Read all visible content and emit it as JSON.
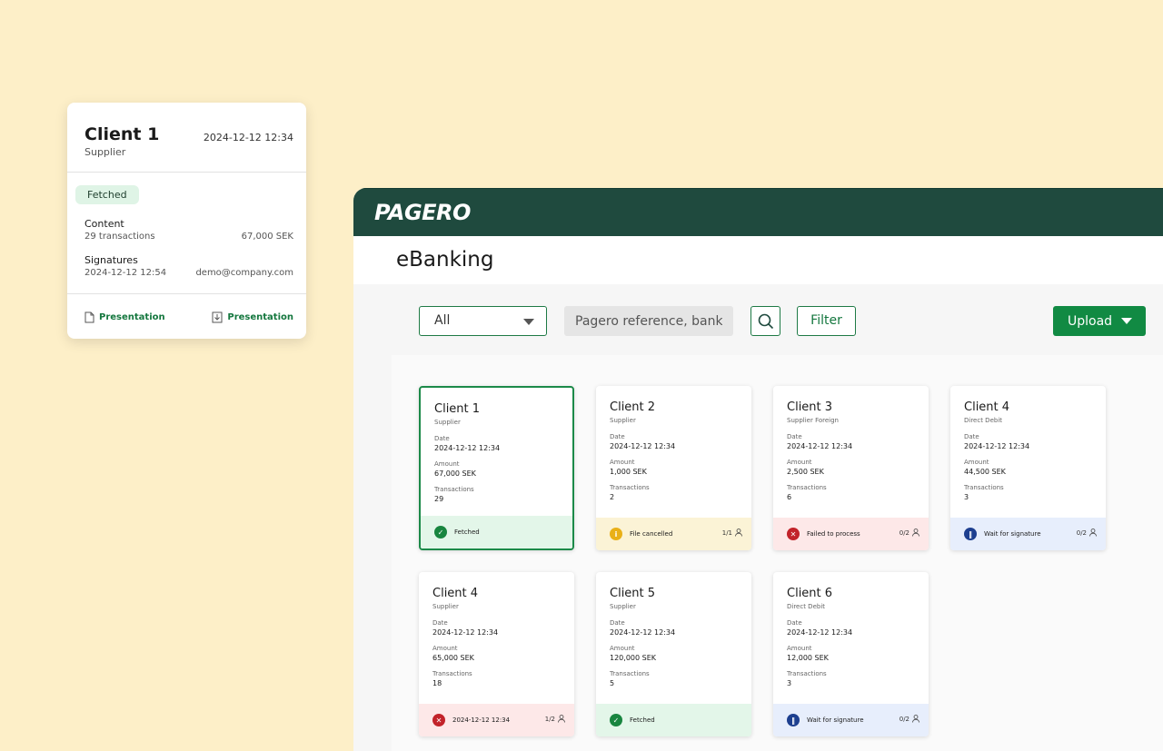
{
  "detail_card": {
    "title": "Client 1",
    "subtitle": "Supplier",
    "datetime": "2024-12-12  12:34",
    "status": "Fetched",
    "content_label": "Content",
    "content_transactions": "29 transactions",
    "content_amount": "67,000 SEK",
    "signatures_label": "Signatures",
    "signatures_datetime": "2024-12-12  12:54",
    "signatures_email": "demo@company.com",
    "link_left": "Presentation",
    "link_right": "Presentation"
  },
  "app": {
    "logo": "PAGERO",
    "page_title": "eBanking",
    "toolbar": {
      "select_value": "All",
      "search_placeholder": "Pagero reference, bank...",
      "filter_label": "Filter",
      "upload_label": "Upload"
    },
    "cards": [
      {
        "name": "Client 1",
        "type": "Supplier",
        "date_label": "Date",
        "date": "2024-12-12  12:34",
        "amount_label": "Amount",
        "amount": "67,000 SEK",
        "tx_label": "Transactions",
        "tx": "29",
        "status": "Fetched",
        "status_kind": "green",
        "count": ""
      },
      {
        "name": "Client 2",
        "type": "Supplier",
        "date_label": "Date",
        "date": "2024-12-12  12:34",
        "amount_label": "Amount",
        "amount": "1,000 SEK",
        "tx_label": "Transactions",
        "tx": "2",
        "status": "File cancelled",
        "status_kind": "yellow",
        "count": "1/1"
      },
      {
        "name": "Client 3",
        "type": "Supplier Foreign",
        "date_label": "Date",
        "date": "2024-12-12  12:34",
        "amount_label": "Amount",
        "amount": "2,500 SEK",
        "tx_label": "Transactions",
        "tx": "6",
        "status": "Failed to process",
        "status_kind": "red",
        "count": "0/2"
      },
      {
        "name": "Client 4",
        "type": "Direct Debit",
        "date_label": "Date",
        "date": "2024-12-12  12:34",
        "amount_label": "Amount",
        "amount": "44,500 SEK",
        "tx_label": "Transactions",
        "tx": "3",
        "status": "Wait for signature",
        "status_kind": "blue",
        "count": "0/2"
      },
      {
        "name": "Client 4",
        "type": "Supplier",
        "date_label": "Date",
        "date": "2024-12-12  12:34",
        "amount_label": "Amount",
        "amount": "65,000 SEK",
        "tx_label": "Transactions",
        "tx": "18",
        "status": "2024-12-12  12:34",
        "status_kind": "red",
        "count": "1/2"
      },
      {
        "name": "Client 5",
        "type": "Supplier",
        "date_label": "Date",
        "date": "2024-12-12  12:34",
        "amount_label": "Amount",
        "amount": "120,000 SEK",
        "tx_label": "Transactions",
        "tx": "5",
        "status": "Fetched",
        "status_kind": "green",
        "count": ""
      },
      {
        "name": "Client 6",
        "type": "Direct Debit",
        "date_label": "Date",
        "date": "2024-12-12  12:34",
        "amount_label": "Amount",
        "amount": "12,000 SEK",
        "tx_label": "Transactions",
        "tx": "3",
        "status": "Wait for signature",
        "status_kind": "blue",
        "count": "0/2"
      }
    ]
  },
  "icons": {
    "green": "check-circle-icon",
    "yellow": "info-circle-icon",
    "red": "x-circle-icon",
    "blue": "pause-circle-icon"
  }
}
